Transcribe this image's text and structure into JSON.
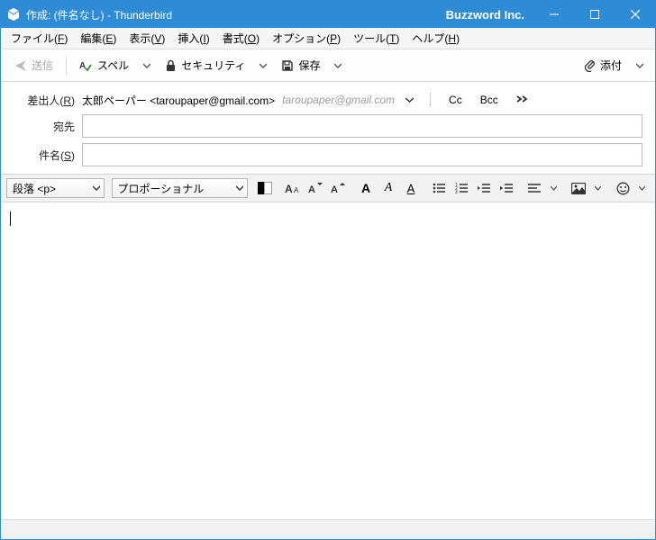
{
  "titlebar": {
    "title": "作成: (件名なし) - Thunderbird",
    "brand": "Buzzword Inc."
  },
  "menu": {
    "file": "ファイル(",
    "file_m": "F",
    "edit": "編集(",
    "edit_m": "E",
    "view": "表示(",
    "view_m": "V",
    "insert": "挿入(",
    "insert_m": "I",
    "format": "書式(",
    "format_m": "O",
    "options": "オプション(",
    "options_m": "P",
    "tools": "ツール(",
    "tools_m": "T",
    "help": "ヘルプ(",
    "help_m": "H",
    "close": ")"
  },
  "toolbar": {
    "send": "送信",
    "spell": "スペル",
    "security": "セキュリティ",
    "save": "保存",
    "attach": "添付"
  },
  "headers": {
    "from_label": "差出人(",
    "from_m": "R",
    "from_close": ")",
    "from_name": "太郎ペーパー <taroupaper@gmail.com>",
    "from_grey": "taroupaper@gmail.com",
    "to_label": "宛先",
    "subject_label": "件名(",
    "subject_m": "S",
    "subject_close": ")",
    "cc": "Cc",
    "bcc": "Bcc"
  },
  "fmtbar": {
    "paragraph": "段落 <p>",
    "font": "プロポーショナル"
  }
}
